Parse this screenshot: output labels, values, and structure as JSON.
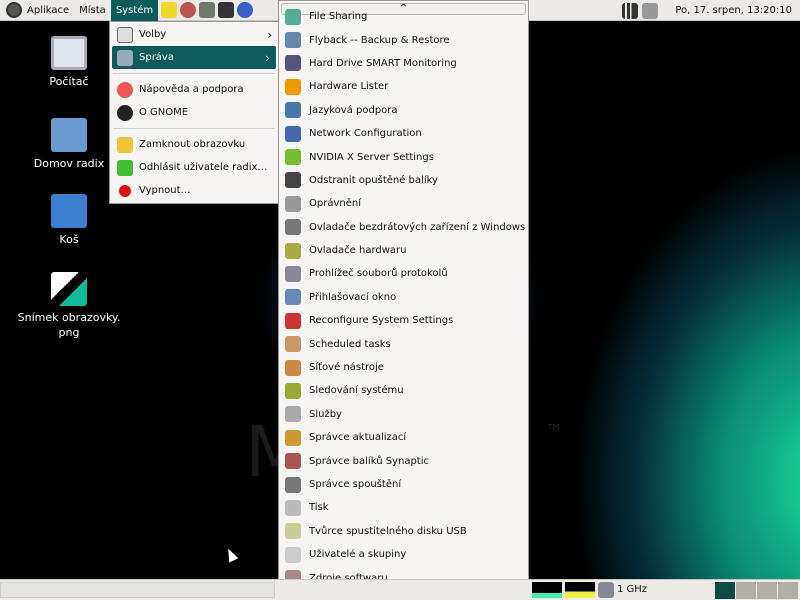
{
  "panel": {
    "menus": [
      "Aplikace",
      "Místa",
      "Systém"
    ],
    "clock": "Po, 17. srpen, 13:20:10",
    "launchers": [
      "text-editor-icon",
      "synaptic-icon",
      "calculator-icon",
      "terminal-icon",
      "browser-icon"
    ]
  },
  "desktop": {
    "icons": [
      {
        "label": "Počítač",
        "icon": "computer-icon"
      },
      {
        "label": "Domov radix",
        "icon": "home-folder-icon"
      },
      {
        "label": "Koš",
        "icon": "trash-icon"
      },
      {
        "label": "Snímek obrazovky.\npng",
        "icon": "image-file-icon"
      }
    ],
    "wallpaper_text": "M        x",
    "tm": "™"
  },
  "system_menu": {
    "items": [
      {
        "label": "Volby",
        "submenu": true
      },
      {
        "label": "Správa",
        "submenu": true,
        "selected": true
      },
      {
        "label": "Nápověda a podpora"
      },
      {
        "label": "O GNOME"
      },
      {
        "label": "Zamknout obrazovku"
      },
      {
        "label": "Odhlásit uživatele radix…"
      },
      {
        "label": "Vypnout…"
      }
    ]
  },
  "admin_submenu": {
    "scroll_up": "^",
    "scroll_down": "⌄",
    "items": [
      "File Sharing",
      "Flyback -- Backup & Restore",
      "Hard Drive SMART Monitoring",
      "Hardware Lister",
      "Jazyková podpora",
      "Network Configuration",
      "NVIDIA X Server Settings",
      "Odstranit opuštěné balíky",
      "Oprávnění",
      "Ovladače bezdrátových zařízení z Windows",
      "Ovladače hardwaru",
      "Prohlížeč souborů protokolů",
      "Přihlašovací okno",
      "Reconfigure System Settings",
      "Scheduled tasks",
      "Síťové nástroje",
      "Sledování systému",
      "Služby",
      "Správce aktualizací",
      "Správce balíků Synaptic",
      "Správce spouštění",
      "Tisk",
      "Tvůrce spustitelného disku USB",
      "Uživatelé a skupiny",
      "Zdroje softwaru"
    ]
  },
  "bottom_panel": {
    "cpu_freq": "1 GHz",
    "workspaces": 4,
    "active_workspace": 1
  },
  "colors": {
    "accent": "#0d5b5b",
    "panel": "#ecebe8",
    "menu": "#f6f5f3"
  }
}
